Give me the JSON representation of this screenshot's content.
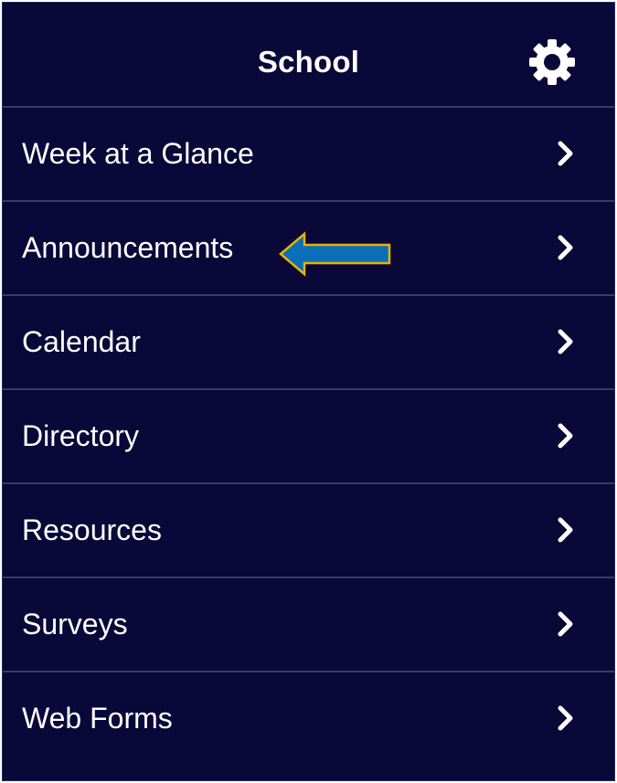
{
  "header": {
    "title": "School",
    "settings_icon": "gear-icon"
  },
  "menu": {
    "items": [
      {
        "label": "Week at a Glance",
        "icon": "chevron-right-icon"
      },
      {
        "label": "Announcements",
        "icon": "chevron-right-icon"
      },
      {
        "label": "Calendar",
        "icon": "chevron-right-icon"
      },
      {
        "label": "Directory",
        "icon": "chevron-right-icon"
      },
      {
        "label": "Resources",
        "icon": "chevron-right-icon"
      },
      {
        "label": "Surveys",
        "icon": "chevron-right-icon"
      },
      {
        "label": "Web Forms",
        "icon": "chevron-right-icon"
      }
    ]
  },
  "annotation": {
    "icon": "left-arrow-annotation",
    "fill": "#0a6fb8",
    "stroke": "#e5b400"
  },
  "colors": {
    "background": "#0a0838",
    "divider": "#3a3a66",
    "text": "#ffffff"
  }
}
